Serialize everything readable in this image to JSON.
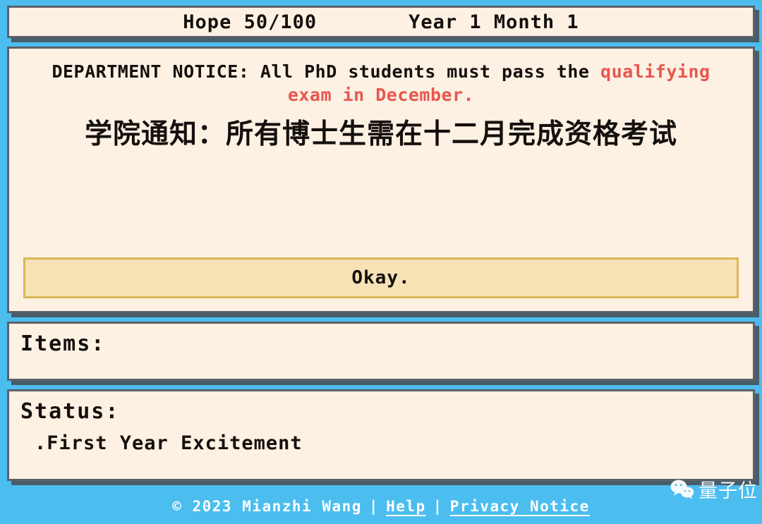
{
  "statusbar": {
    "hope_label": "Hope 50/100",
    "date_label": "Year 1 Month 1"
  },
  "notice": {
    "english_prefix": "DEPARTMENT NOTICE: All PhD students must pass the ",
    "english_highlight": "qualifying exam in December.",
    "chinese": "学院通知：所有博士生需在十二月完成资格考试",
    "highlight_color": "#e8564f"
  },
  "choices": [
    {
      "label": "Okay."
    }
  ],
  "items": {
    "title": "Items:",
    "entries": []
  },
  "status": {
    "title": "Status:",
    "entries": [
      ".First Year Excitement"
    ]
  },
  "footer": {
    "copyright": "© 2023 Mianzhi Wang",
    "separator": "|",
    "help_label": "Help",
    "privacy_label": "Privacy Notice"
  },
  "watermark": {
    "icon": "wechat-icon",
    "text": "量子位"
  },
  "theme": {
    "background": "#4cbdef",
    "panel_fill": "#fdf1e3",
    "panel_border": "#5b6168",
    "button_fill": "#f6e2b5",
    "button_border": "#dcb758",
    "text": "#14100d"
  }
}
